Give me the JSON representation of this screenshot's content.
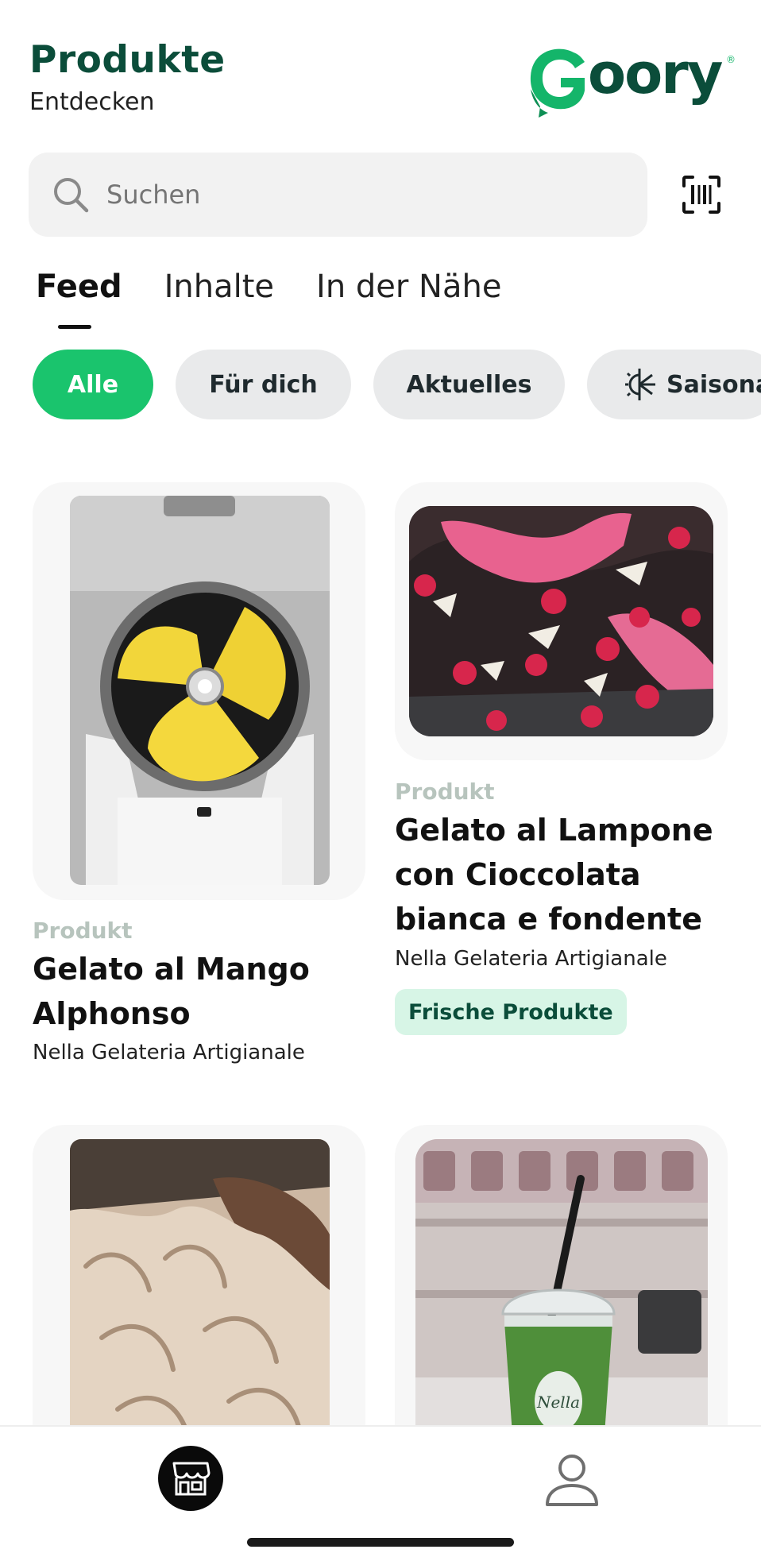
{
  "header": {
    "title": "Produkte",
    "subtitle": "Entdecken",
    "logo_text": "Goory"
  },
  "search": {
    "placeholder": "Suchen",
    "icon": "search-icon",
    "scan_icon": "barcode-scan-icon"
  },
  "tabs": [
    {
      "label": "Feed",
      "active": true
    },
    {
      "label": "Inhalte",
      "active": false
    },
    {
      "label": "In der Nähe",
      "active": false
    }
  ],
  "chips": [
    {
      "label": "Alle",
      "active": true
    },
    {
      "label": "Für dich",
      "active": false
    },
    {
      "label": "Aktuelles",
      "active": false
    },
    {
      "label": "Saisona",
      "active": false,
      "icon": "seasonal-sun-snow-icon"
    }
  ],
  "products": [
    {
      "label": "Produkt",
      "name_line1": "Gelato al Mango",
      "name_line2": "Alphonso",
      "shop": "Nella Gelateria Artigianale"
    },
    {
      "label": "Produkt",
      "name_line1": "Gelato al Lampone",
      "name_line2": "con Cioccolata",
      "name_line3": "bianca e fondente",
      "shop": "Nella Gelateria Artigianale",
      "badge": "Frische Produkte"
    }
  ],
  "bottom_nav": {
    "shop_icon": "storefront-icon",
    "profile_icon": "user-profile-icon"
  },
  "colors": {
    "brand_dark": "#0b4d3a",
    "brand_green": "#1ac46d",
    "badge_bg": "#d7f5e6"
  }
}
